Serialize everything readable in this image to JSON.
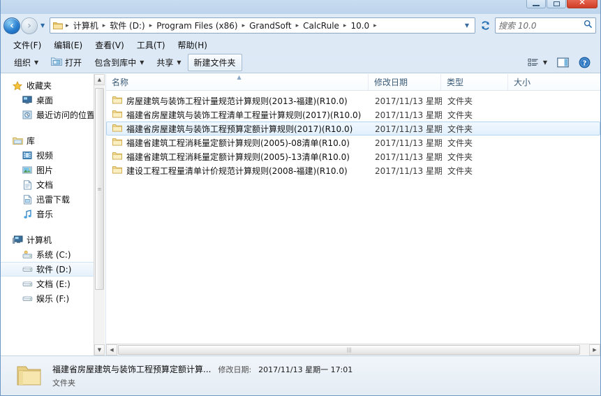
{
  "window": {
    "controls": {
      "minimize": "—",
      "maximize": "□",
      "close": "✕"
    }
  },
  "address": {
    "back_tooltip": "后退",
    "forward_tooltip": "前进",
    "history_caret": "▼",
    "crumbs": [
      "计算机",
      "软件 (D:)",
      "Program Files (x86)",
      "GrandSoft",
      "CalcRule",
      "10.0"
    ],
    "separator": "▸",
    "dropdown_caret": "▼",
    "refresh_glyph": "↻"
  },
  "search": {
    "placeholder": "搜索 10.0",
    "value": "",
    "icon": "search-icon"
  },
  "menu": {
    "items": [
      {
        "label": "文件(F)"
      },
      {
        "label": "编辑(E)"
      },
      {
        "label": "查看(V)"
      },
      {
        "label": "工具(T)"
      },
      {
        "label": "帮助(H)"
      }
    ]
  },
  "toolbar": {
    "organize_label": "组织",
    "open_label": "打开",
    "include_library_label": "包含到库中",
    "share_label": "共享",
    "new_folder_label": "新建文件夹",
    "caret": "▼",
    "view_icon": "view-options-icon",
    "preview_icon": "preview-pane-icon",
    "help_icon": "help-icon"
  },
  "sidebar": {
    "groups": [
      {
        "header": {
          "label": "收藏夹",
          "icon": "star-icon"
        },
        "items": [
          {
            "label": "桌面",
            "icon": "desktop-icon",
            "selected": false
          },
          {
            "label": "最近访问的位置",
            "icon": "recent-places-icon",
            "selected": false
          }
        ]
      },
      {
        "header": {
          "label": "库",
          "icon": "library-icon"
        },
        "items": [
          {
            "label": "视频",
            "icon": "video-icon",
            "selected": false
          },
          {
            "label": "图片",
            "icon": "pictures-icon",
            "selected": false
          },
          {
            "label": "文档",
            "icon": "documents-icon",
            "selected": false
          },
          {
            "label": "迅雷下载",
            "icon": "downloads-icon",
            "selected": false
          },
          {
            "label": "音乐",
            "icon": "music-icon",
            "selected": false
          }
        ]
      },
      {
        "header": {
          "label": "计算机",
          "icon": "computer-icon"
        },
        "items": [
          {
            "label": "系统 (C:)",
            "icon": "system-drive-icon",
            "selected": false
          },
          {
            "label": "软件 (D:)",
            "icon": "drive-icon",
            "selected": true
          },
          {
            "label": "文档 (E:)",
            "icon": "drive-icon",
            "selected": false
          },
          {
            "label": "娱乐 (F:)",
            "icon": "drive-icon",
            "selected": false
          }
        ]
      }
    ]
  },
  "filelist": {
    "columns": [
      {
        "key": "name",
        "label": "名称"
      },
      {
        "key": "date",
        "label": "修改日期"
      },
      {
        "key": "type",
        "label": "类型"
      },
      {
        "key": "size",
        "label": "大小"
      }
    ],
    "rows": [
      {
        "name": "房屋建筑与装饰工程计量规范计算规则(2013-福建)(R10.0)",
        "date": "2017/11/13 星期...",
        "type": "文件夹",
        "size": "",
        "selected": false
      },
      {
        "name": "福建省房屋建筑与装饰工程清单工程量计算规则(2017)(R10.0)",
        "date": "2017/11/13 星期...",
        "type": "文件夹",
        "size": "",
        "selected": false
      },
      {
        "name": "福建省房屋建筑与装饰工程预算定额计算规则(2017)(R10.0)",
        "date": "2017/11/13 星期...",
        "type": "文件夹",
        "size": "",
        "selected": true
      },
      {
        "name": "福建省建筑工程消耗量定额计算规则(2005)-08清单(R10.0)",
        "date": "2017/11/13 星期...",
        "type": "文件夹",
        "size": "",
        "selected": false
      },
      {
        "name": "福建省建筑工程消耗量定额计算规则(2005)-13清单(R10.0)",
        "date": "2017/11/13 星期...",
        "type": "文件夹",
        "size": "",
        "selected": false
      },
      {
        "name": "建设工程工程量清单计价规范计算规则(2008-福建)(R10.0)",
        "date": "2017/11/13 星期...",
        "type": "文件夹",
        "size": "",
        "selected": false
      }
    ]
  },
  "details": {
    "title": "福建省房屋建筑与装饰工程预算定额计算...",
    "modified_label": "修改日期:",
    "modified_value": "2017/11/13 星期一  17:01",
    "kind": "文件夹",
    "icon": "large-folder-icon"
  },
  "colors": {
    "accent": "#2a7fd0",
    "selection_bg": "#e2f0fc",
    "selection_border": "#b4d5f0",
    "chrome_top": "#dfeaf6",
    "close_button": "#cf3d26",
    "folder_yellow": "#f5d98a"
  }
}
